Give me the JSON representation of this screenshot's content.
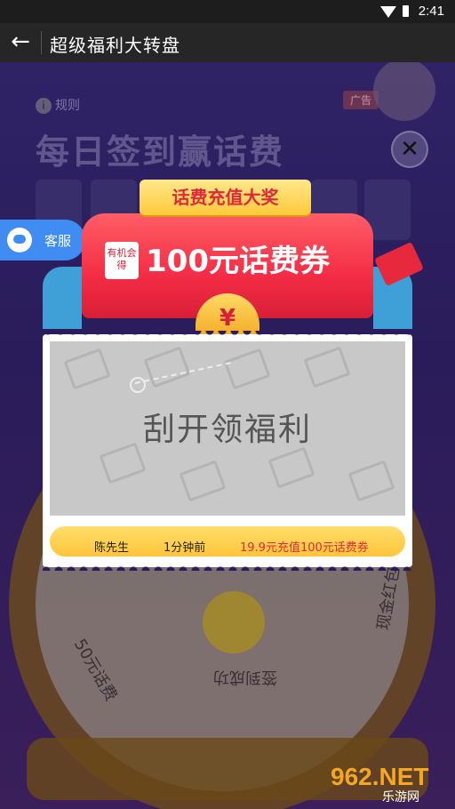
{
  "status_bar": {
    "time": "2:41"
  },
  "app_bar": {
    "title": "超级福利大转盘"
  },
  "background": {
    "rules": "规则",
    "headline": "每日签到赢话费",
    "ad": "广告",
    "wheel_labels": [
      "50元话费",
      "签到成功",
      "现金红包"
    ]
  },
  "customer_service": {
    "label": "客服"
  },
  "popup": {
    "ribbon": "话费充值大奖",
    "badge": "有机会得",
    "amount": "100元话费券",
    "currency": "¥",
    "scratch_text": "刮开领福利",
    "winners": [
      {
        "name": "陈先生",
        "time": "1分钟前",
        "prize": "19.9元充值100元话费券"
      }
    ]
  },
  "watermark": {
    "brand": "962.NET",
    "site": "乐游网"
  }
}
